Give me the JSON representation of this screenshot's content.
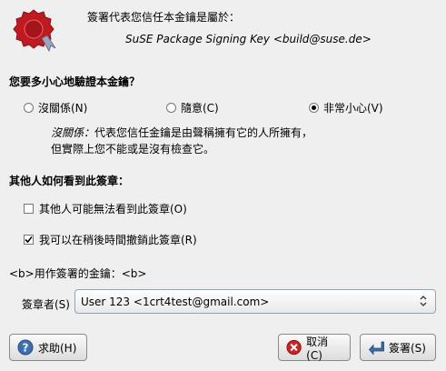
{
  "header": {
    "intro": "簽署代表您信任本金鑰是屬於：",
    "key_identity": "SuSE Package Signing Key <build@suse.de>"
  },
  "verification": {
    "question": "您要多小心地驗證本金鑰？",
    "options": [
      {
        "label": "沒關係(N)",
        "checked": false
      },
      {
        "label": "隨意(C)",
        "checked": false
      },
      {
        "label": "非常小心(V)",
        "checked": true
      }
    ],
    "description_italic": "沒關係：",
    "description_line1": "代表您信任金鑰是由聲稱擁有它的人所擁有，",
    "description_line2": "但實際上您不能或是沒有檢查它。"
  },
  "visibility": {
    "question": "其他人如何看到此簽章：",
    "options": [
      {
        "label": "其他人可能無法看到此簽章(O)",
        "checked": false
      },
      {
        "label": "我可以在稍後時間撤銷此簽章(R)",
        "checked": true
      }
    ]
  },
  "signing_key": {
    "label": "<b>用作簽署的金鑰：<b>",
    "signer_label": "簽章者(S)",
    "signer_value": "User 123 <1crt4test@gmail.com>"
  },
  "buttons": {
    "help": "求助(H)",
    "cancel": "取消(C)",
    "sign": "簽署(S)"
  },
  "colors": {
    "seal_red": "#c0191f",
    "cancel_icon": "#d02020",
    "sign_icon": "#3a6fb5",
    "help_icon": "#3a6fb5"
  }
}
